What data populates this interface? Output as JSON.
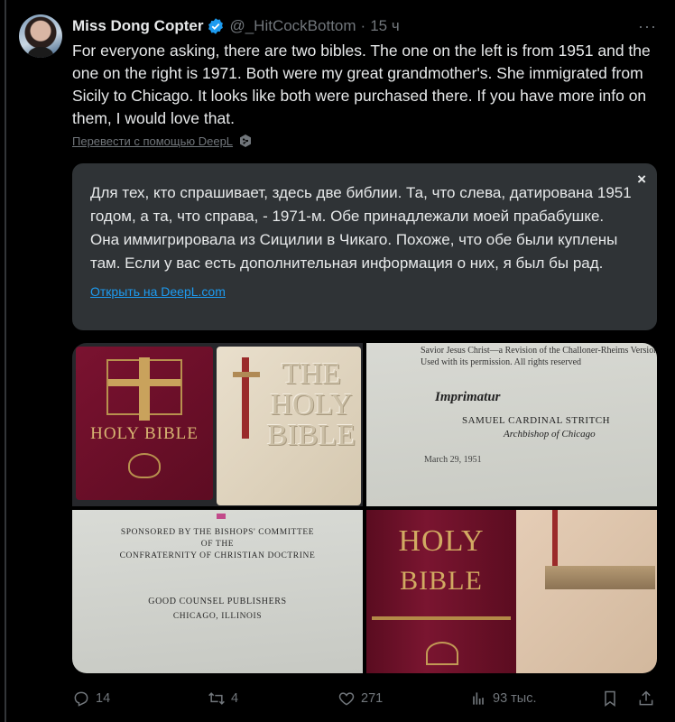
{
  "author": {
    "name": "Miss Dong Copter",
    "handle": "@_HitCockBottom",
    "separator": "·",
    "time": "15 ч"
  },
  "more_label": "···",
  "tweet_text": "For everyone asking, there are two bibles. The one on the left is from 1951 and the one on the right is 1971. Both were my great grandmother's. She immigrated from Sicily to Chicago. It looks like both were purchased there. If you have more info on them, I would love that.",
  "translate_label": "Перевести с помощью DeepL",
  "translation": {
    "text": "Для тех, кто спрашивает, здесь две библии. Та, что слева, датирована 1951 годом, а та, что справа, - 1971-м. Обе принадлежали моей прабабушке. Она иммигрировала из Сицилии в Чикаго. Похоже, что обе были куплены там. Если у вас есть дополнительная информация о них, я был бы рад.",
    "link": "Открыть на DeepL.com",
    "close": "×"
  },
  "media": {
    "tile1": {
      "red_title": "HOLY BIBLE",
      "white_title": "THE HOLY BIBLE"
    },
    "tile2": {
      "top_text": "Savior Jesus Christ—a Revision of the Challoner-Rheims Version.\" Used with its permission. All rights reserved",
      "imprimatur": "Imprimatur",
      "line1": "SAMUEL CARDINAL STRITCH",
      "line2": "Archbishop of Chicago",
      "date": "March 29, 1951"
    },
    "tile3": {
      "l1": "SPONSORED BY THE BISHOPS' COMMITTEE",
      "l2": "OF THE",
      "l3": "CONFRATERNITY OF CHRISTIAN DOCTRINE",
      "l4": "GOOD COUNSEL PUBLISHERS",
      "l5": "CHICAGO, ILLINOIS"
    },
    "tile4": {
      "title1": "HOLY",
      "title2": "BIBLE"
    }
  },
  "actions": {
    "replies": "14",
    "reposts": "4",
    "likes": "271",
    "views": "93 тыс."
  },
  "colors": {
    "background": "#000000",
    "accent": "#1d9bf0",
    "muted": "#71767b",
    "card": "#2f3336"
  }
}
